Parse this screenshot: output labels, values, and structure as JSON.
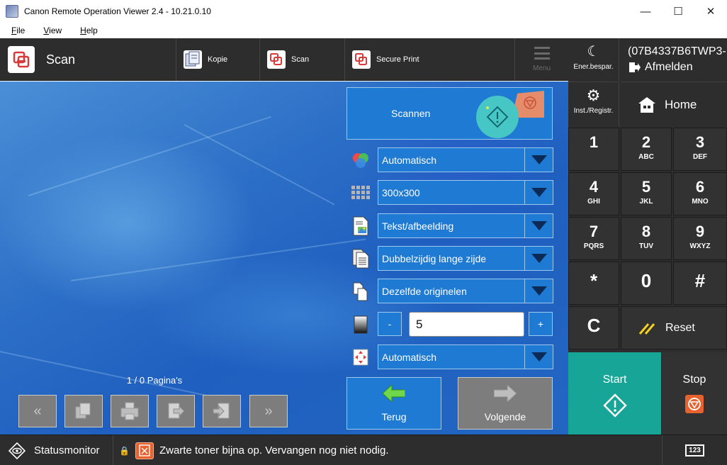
{
  "window": {
    "title": "Canon Remote Operation Viewer 2.4 - 10.21.0.10",
    "minimize": "—",
    "maximize": "☐",
    "close": "✕"
  },
  "menu": {
    "items": [
      {
        "underline": "F",
        "rest": "ile"
      },
      {
        "underline": "V",
        "rest": "iew"
      },
      {
        "underline": "H",
        "rest": "elp"
      }
    ]
  },
  "header": {
    "current_function": "Scan",
    "functions": [
      {
        "label": "Kopie",
        "icon": "copy-icon"
      },
      {
        "label": "Scan",
        "icon": "scan-icon"
      },
      {
        "label": "Secure Print",
        "icon": "secure-print-icon"
      }
    ],
    "menu_label": "Menu"
  },
  "scan": {
    "button_label": "Scannen",
    "settings": [
      {
        "value": "Automatisch",
        "icon": "color-mode-icon"
      },
      {
        "value": "300x300",
        "icon": "resolution-icon"
      },
      {
        "value": "Tekst/afbeelding",
        "icon": "original-type-icon"
      },
      {
        "value": "Dubbelzijdig lange zijde",
        "icon": "duplex-icon"
      },
      {
        "value": "Dezelfde originelen",
        "icon": "original-size-icon"
      }
    ],
    "density": {
      "minus": "-",
      "value": "5",
      "plus": "+"
    },
    "size_setting": {
      "value": "Automatisch",
      "icon": "size-icon"
    },
    "page_info": "1 / 0 Pagina's",
    "back_label": "Terug",
    "next_label": "Volgende"
  },
  "right_panel": {
    "energy_label": "Ener.bespar.",
    "user_id": "(07B4337B6TWP3-",
    "logout_label": "Afmelden",
    "settings_label": "Inst./Registr.",
    "home_label": "Home",
    "keys": [
      {
        "digit": "1",
        "sub": ""
      },
      {
        "digit": "2",
        "sub": "ABC"
      },
      {
        "digit": "3",
        "sub": "DEF"
      },
      {
        "digit": "4",
        "sub": "GHI"
      },
      {
        "digit": "5",
        "sub": "JKL"
      },
      {
        "digit": "6",
        "sub": "MNO"
      },
      {
        "digit": "7",
        "sub": "PQRS"
      },
      {
        "digit": "8",
        "sub": "TUV"
      },
      {
        "digit": "9",
        "sub": "WXYZ"
      },
      {
        "digit": "*",
        "sub": ""
      },
      {
        "digit": "0",
        "sub": ""
      },
      {
        "digit": "#",
        "sub": ""
      }
    ],
    "clear_label": "C",
    "reset_label": "Reset",
    "start_label": "Start",
    "stop_label": "Stop"
  },
  "statusbar": {
    "status_monitor_label": "Statusmonitor",
    "message": "Zwarte toner bijna op. Vervangen nog niet nodig.",
    "keyboard_label": "123"
  },
  "colors": {
    "panel_dark": "#2d2d2d",
    "button_blue": "#1f7ad4",
    "start_teal": "#17a597",
    "stop_orange": "#e8622f"
  }
}
